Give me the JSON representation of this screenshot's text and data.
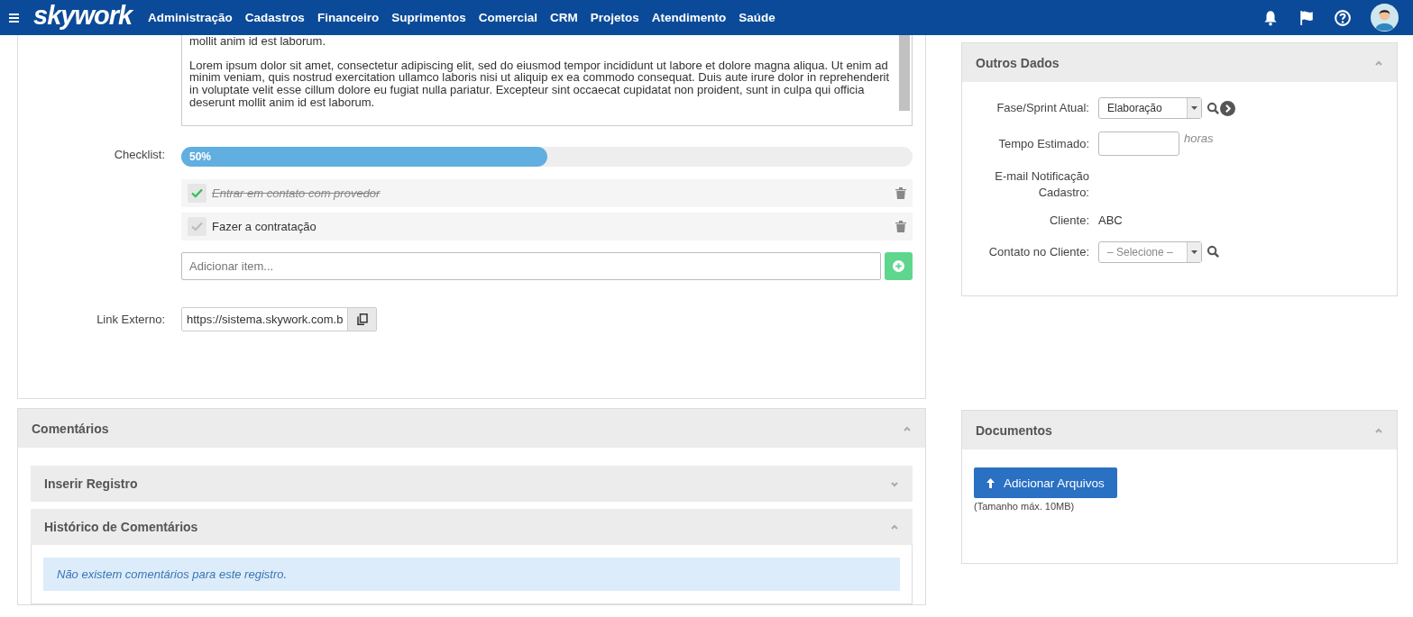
{
  "navbar": {
    "logo": "skywork",
    "menu": [
      "Administração",
      "Cadastros",
      "Financeiro",
      "Suprimentos",
      "Comercial",
      "CRM",
      "Projetos",
      "Atendimento",
      "Saúde"
    ]
  },
  "description": {
    "paragraphs": [
      "mollit anim id est laborum.",
      "Lorem ipsum dolor sit amet, consectetur adipiscing elit, sed do eiusmod tempor incididunt ut labore et dolore magna aliqua. Ut enim ad minim veniam, quis nostrud exercitation ullamco laboris nisi ut aliquip ex ea commodo consequat. Duis aute irure dolor in reprehenderit in voluptate velit esse cillum dolore eu fugiat nulla pariatur. Excepteur sint occaecat cupidatat non proident, sunt in culpa qui officia deserunt mollit anim id est laborum."
    ]
  },
  "checklist": {
    "label": "Checklist:",
    "progress_text": "50%",
    "level": 0.5,
    "items": [
      {
        "text": "Entrar em contato com provedor",
        "checked": true
      },
      {
        "text": "Fazer a contratação",
        "checked": false
      }
    ],
    "add_placeholder": "Adicionar item..."
  },
  "external_link": {
    "label": "Link Externo:",
    "value": "https://sistema.skywork.com.b"
  },
  "comments": {
    "title": "Comentários",
    "expanded": true,
    "sections": [
      {
        "title": "Inserir Registro",
        "expanded": false
      },
      {
        "title": "Histórico de Comentários",
        "expanded": true,
        "message": "Não existem comentários para este registro."
      }
    ]
  },
  "other_data": {
    "title": "Outros Dados",
    "expanded": true,
    "fields": [
      {
        "kind": "select",
        "label": "Fase/Sprint Atual:",
        "value": "Elaboração",
        "search": true,
        "next": true
      },
      {
        "kind": "input",
        "label": "Tempo Estimado:",
        "suffix": "horas"
      },
      {
        "kind": "text",
        "label": "E-mail Notificação Cadastro:"
      },
      {
        "kind": "text",
        "label": "Cliente:",
        "value": "ABC"
      },
      {
        "kind": "select",
        "label": "Contato no Cliente:",
        "placeholder": "– Selecione –",
        "search": true
      }
    ]
  },
  "documents": {
    "title": "Documentos",
    "expanded": true,
    "button": "Adicionar Arquivos",
    "note": "(Tamanho máx. 10MB)"
  }
}
